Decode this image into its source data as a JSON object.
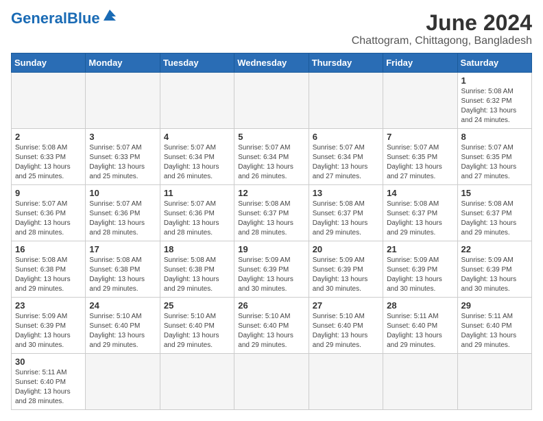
{
  "header": {
    "logo_general": "General",
    "logo_blue": "Blue",
    "month_title": "June 2024",
    "subtitle": "Chattogram, Chittagong, Bangladesh"
  },
  "days_of_week": [
    "Sunday",
    "Monday",
    "Tuesday",
    "Wednesday",
    "Thursday",
    "Friday",
    "Saturday"
  ],
  "weeks": [
    [
      {
        "day": "",
        "info": ""
      },
      {
        "day": "",
        "info": ""
      },
      {
        "day": "",
        "info": ""
      },
      {
        "day": "",
        "info": ""
      },
      {
        "day": "",
        "info": ""
      },
      {
        "day": "",
        "info": ""
      },
      {
        "day": "1",
        "info": "Sunrise: 5:08 AM\nSunset: 6:32 PM\nDaylight: 13 hours and 24 minutes."
      }
    ],
    [
      {
        "day": "2",
        "info": "Sunrise: 5:08 AM\nSunset: 6:33 PM\nDaylight: 13 hours and 25 minutes."
      },
      {
        "day": "3",
        "info": "Sunrise: 5:07 AM\nSunset: 6:33 PM\nDaylight: 13 hours and 25 minutes."
      },
      {
        "day": "4",
        "info": "Sunrise: 5:07 AM\nSunset: 6:34 PM\nDaylight: 13 hours and 26 minutes."
      },
      {
        "day": "5",
        "info": "Sunrise: 5:07 AM\nSunset: 6:34 PM\nDaylight: 13 hours and 26 minutes."
      },
      {
        "day": "6",
        "info": "Sunrise: 5:07 AM\nSunset: 6:34 PM\nDaylight: 13 hours and 27 minutes."
      },
      {
        "day": "7",
        "info": "Sunrise: 5:07 AM\nSunset: 6:35 PM\nDaylight: 13 hours and 27 minutes."
      },
      {
        "day": "8",
        "info": "Sunrise: 5:07 AM\nSunset: 6:35 PM\nDaylight: 13 hours and 27 minutes."
      }
    ],
    [
      {
        "day": "9",
        "info": "Sunrise: 5:07 AM\nSunset: 6:36 PM\nDaylight: 13 hours and 28 minutes."
      },
      {
        "day": "10",
        "info": "Sunrise: 5:07 AM\nSunset: 6:36 PM\nDaylight: 13 hours and 28 minutes."
      },
      {
        "day": "11",
        "info": "Sunrise: 5:07 AM\nSunset: 6:36 PM\nDaylight: 13 hours and 28 minutes."
      },
      {
        "day": "12",
        "info": "Sunrise: 5:08 AM\nSunset: 6:37 PM\nDaylight: 13 hours and 28 minutes."
      },
      {
        "day": "13",
        "info": "Sunrise: 5:08 AM\nSunset: 6:37 PM\nDaylight: 13 hours and 29 minutes."
      },
      {
        "day": "14",
        "info": "Sunrise: 5:08 AM\nSunset: 6:37 PM\nDaylight: 13 hours and 29 minutes."
      },
      {
        "day": "15",
        "info": "Sunrise: 5:08 AM\nSunset: 6:37 PM\nDaylight: 13 hours and 29 minutes."
      }
    ],
    [
      {
        "day": "16",
        "info": "Sunrise: 5:08 AM\nSunset: 6:38 PM\nDaylight: 13 hours and 29 minutes."
      },
      {
        "day": "17",
        "info": "Sunrise: 5:08 AM\nSunset: 6:38 PM\nDaylight: 13 hours and 29 minutes."
      },
      {
        "day": "18",
        "info": "Sunrise: 5:08 AM\nSunset: 6:38 PM\nDaylight: 13 hours and 29 minutes."
      },
      {
        "day": "19",
        "info": "Sunrise: 5:09 AM\nSunset: 6:39 PM\nDaylight: 13 hours and 30 minutes."
      },
      {
        "day": "20",
        "info": "Sunrise: 5:09 AM\nSunset: 6:39 PM\nDaylight: 13 hours and 30 minutes."
      },
      {
        "day": "21",
        "info": "Sunrise: 5:09 AM\nSunset: 6:39 PM\nDaylight: 13 hours and 30 minutes."
      },
      {
        "day": "22",
        "info": "Sunrise: 5:09 AM\nSunset: 6:39 PM\nDaylight: 13 hours and 30 minutes."
      }
    ],
    [
      {
        "day": "23",
        "info": "Sunrise: 5:09 AM\nSunset: 6:39 PM\nDaylight: 13 hours and 30 minutes."
      },
      {
        "day": "24",
        "info": "Sunrise: 5:10 AM\nSunset: 6:40 PM\nDaylight: 13 hours and 29 minutes."
      },
      {
        "day": "25",
        "info": "Sunrise: 5:10 AM\nSunset: 6:40 PM\nDaylight: 13 hours and 29 minutes."
      },
      {
        "day": "26",
        "info": "Sunrise: 5:10 AM\nSunset: 6:40 PM\nDaylight: 13 hours and 29 minutes."
      },
      {
        "day": "27",
        "info": "Sunrise: 5:10 AM\nSunset: 6:40 PM\nDaylight: 13 hours and 29 minutes."
      },
      {
        "day": "28",
        "info": "Sunrise: 5:11 AM\nSunset: 6:40 PM\nDaylight: 13 hours and 29 minutes."
      },
      {
        "day": "29",
        "info": "Sunrise: 5:11 AM\nSunset: 6:40 PM\nDaylight: 13 hours and 29 minutes."
      }
    ],
    [
      {
        "day": "30",
        "info": "Sunrise: 5:11 AM\nSunset: 6:40 PM\nDaylight: 13 hours and 28 minutes."
      },
      {
        "day": "",
        "info": ""
      },
      {
        "day": "",
        "info": ""
      },
      {
        "day": "",
        "info": ""
      },
      {
        "day": "",
        "info": ""
      },
      {
        "day": "",
        "info": ""
      },
      {
        "day": "",
        "info": ""
      }
    ]
  ]
}
